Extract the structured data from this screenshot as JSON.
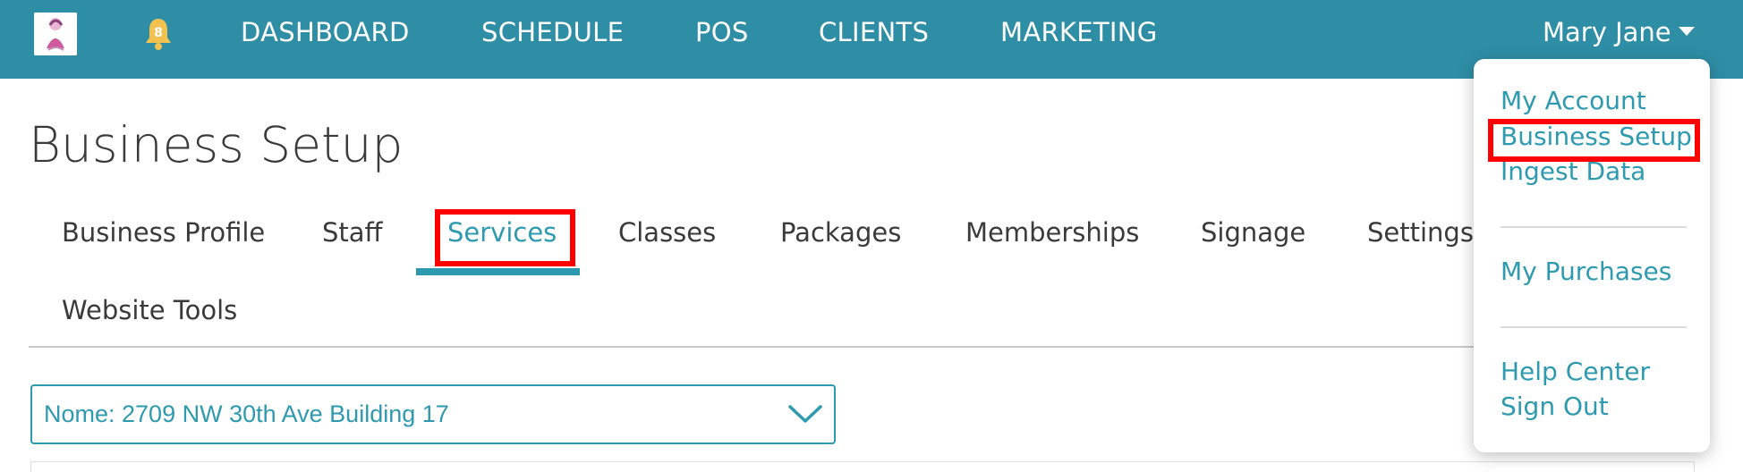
{
  "topbar": {
    "notification_count": "8",
    "nav_items": [
      "DASHBOARD",
      "SCHEDULE",
      "POS",
      "CLIENTS",
      "MARKETING"
    ],
    "user_name": "Mary Jane",
    "colors": {
      "bar": "#2e8ea6",
      "bell": "#f2c14e"
    },
    "icons": {
      "logo": "salon-logo",
      "bell": "bell-icon",
      "caret": "caret-down-icon"
    }
  },
  "page": {
    "title": "Business Setup",
    "tabs": [
      {
        "label": "Business Profile"
      },
      {
        "label": "Staff"
      },
      {
        "label": "Services",
        "active": true
      },
      {
        "label": "Classes"
      },
      {
        "label": "Packages"
      },
      {
        "label": "Memberships"
      },
      {
        "label": "Signage"
      },
      {
        "label": "Settings"
      },
      {
        "label": "Website Tools"
      }
    ],
    "location_select": {
      "value": "Nome: 2709 NW 30th Ave Building 17",
      "icon": "chevron-down-icon"
    },
    "accent_color": "#2e9ab0",
    "highlight_color": "#ff0000"
  },
  "user_dropdown": {
    "items": [
      {
        "label": "My Account"
      },
      {
        "label": "Business Setup",
        "highlighted": true
      },
      {
        "label": "Ingest Data"
      },
      {
        "label": "My Purchases"
      },
      {
        "label": "Help Center"
      },
      {
        "label": "Sign Out"
      }
    ]
  }
}
